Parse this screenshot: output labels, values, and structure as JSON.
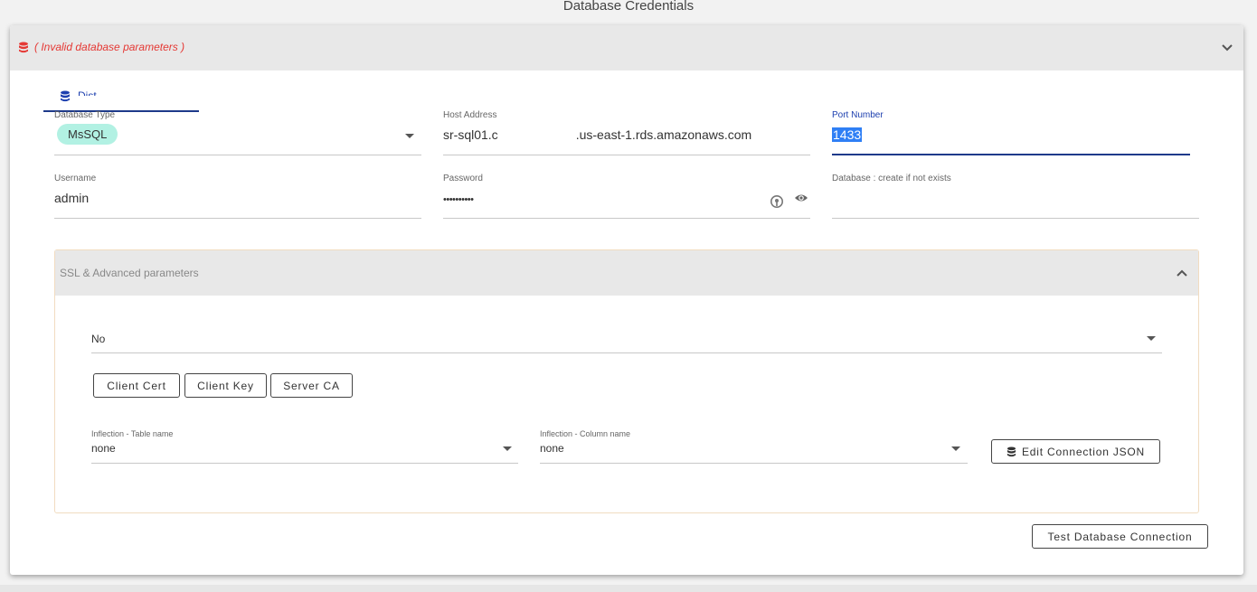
{
  "page": {
    "title": "Database Credentials"
  },
  "panel": {
    "error_text": "( Invalid database parameters )",
    "colors": {
      "error": "#e53935",
      "accent": "#1e3a8a",
      "chip": "#b2f1e3"
    }
  },
  "tab": {
    "label": "Dist...",
    "icon": "database-icon"
  },
  "fields": {
    "database_type": {
      "label": "Database Type",
      "value": "MsSQL"
    },
    "host_address": {
      "label": "Host Address",
      "value_start": "sr-sql01.c",
      "value_end": ".us-east-1.rds.amazonaws.com"
    },
    "port_number": {
      "label": "Port Number",
      "value": "1433"
    },
    "username": {
      "label": "Username",
      "value": "admin"
    },
    "password": {
      "label": "Password",
      "value": "••••••••••"
    },
    "database": {
      "label": "Database : create if not exists"
    }
  },
  "ssl": {
    "title": "SSL & Advanced parameters",
    "ssl_mode": "No",
    "buttons": {
      "client_cert": "Client Cert",
      "client_key": "Client Key",
      "server_ca": "Server CA"
    },
    "inflection_table": {
      "label": "Inflection - Table name",
      "value": "none"
    },
    "inflection_column": {
      "label": "Inflection - Column name",
      "value": "none"
    },
    "edit_json": "Edit Connection JSON"
  },
  "actions": {
    "test_connection": "Test Database Connection"
  }
}
